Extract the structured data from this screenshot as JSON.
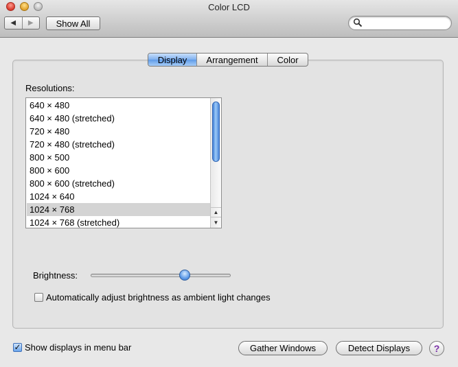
{
  "window": {
    "title": "Color LCD"
  },
  "toolbar": {
    "back_icon": "◀",
    "forward_icon": "▶",
    "show_all_label": "Show All",
    "search_value": "",
    "search_placeholder": ""
  },
  "tabs": [
    {
      "label": "Display",
      "selected": true
    },
    {
      "label": "Arrangement",
      "selected": false
    },
    {
      "label": "Color",
      "selected": false
    }
  ],
  "resolutions": {
    "label": "Resolutions:",
    "items": [
      {
        "label": "640 × 480",
        "selected": false
      },
      {
        "label": "640 × 480 (stretched)",
        "selected": false
      },
      {
        "label": "720 × 480",
        "selected": false
      },
      {
        "label": "720 × 480 (stretched)",
        "selected": false
      },
      {
        "label": "800 × 500",
        "selected": false
      },
      {
        "label": "800 × 600",
        "selected": false
      },
      {
        "label": "800 × 600 (stretched)",
        "selected": false
      },
      {
        "label": "1024 × 640",
        "selected": false
      },
      {
        "label": "1024 × 768",
        "selected": true
      },
      {
        "label": "1024 × 768 (stretched)",
        "selected": false
      }
    ],
    "scroll_up_icon": "▲",
    "scroll_down_icon": "▼"
  },
  "brightness": {
    "label": "Brightness:",
    "level": 0.67
  },
  "auto_brightness": {
    "label": "Automatically adjust brightness as ambient light changes",
    "checked": false
  },
  "footer": {
    "show_in_menubar_label": "Show displays in menu bar",
    "show_in_menubar_checked": true,
    "checkmark": "✓",
    "gather_windows_label": "Gather Windows",
    "detect_displays_label": "Detect Displays",
    "help_label": "?"
  },
  "colors": {
    "accent": "#5f9be8",
    "help": "#7a2ea8"
  }
}
